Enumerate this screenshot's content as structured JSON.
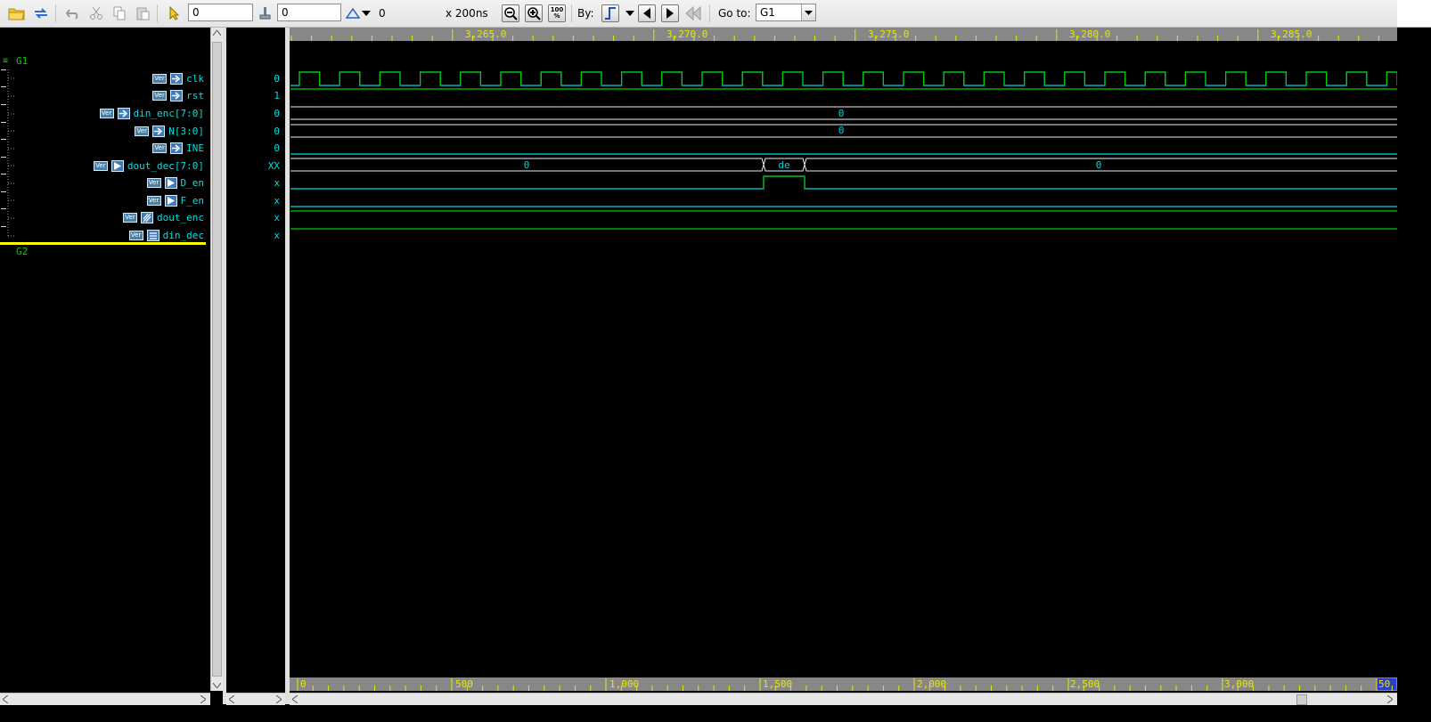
{
  "toolbar": {
    "time_value": "0",
    "cursor_value": "0",
    "delta_value": "0",
    "scale_label": "x 200ns",
    "zoom_full_label": "100 %",
    "by_label": "By:",
    "goto_label": "Go to:",
    "goto_value": "G1"
  },
  "tree": {
    "group1_label": "G1",
    "group2_label": "G2",
    "ver_badge": "Ver",
    "signals": [
      {
        "name": "clk",
        "value": "0",
        "icon": "input-arrow-icon"
      },
      {
        "name": "rst",
        "value": "1",
        "icon": "input-arrow-icon"
      },
      {
        "name": "din_enc[7:0]",
        "value": "0",
        "icon": "input-arrow-icon"
      },
      {
        "name": "N[3:0]",
        "value": "0",
        "icon": "input-arrow-icon"
      },
      {
        "name": "INE",
        "value": "0",
        "icon": "input-arrow-icon"
      },
      {
        "name": "dout_dec[7:0]",
        "value": "XX",
        "icon": "output-arrow-icon"
      },
      {
        "name": "D_en",
        "value": "x",
        "icon": "output-arrow-icon"
      },
      {
        "name": "F_en",
        "value": "x",
        "icon": "output-arrow-icon"
      },
      {
        "name": "dout_enc",
        "value": "x",
        "icon": "inout-icon"
      },
      {
        "name": "din_dec",
        "value": "x",
        "icon": "internal-icon"
      }
    ]
  },
  "wave": {
    "top_ticks": [
      "3,265.0",
      "3,270.0",
      "3,275.0",
      "3,280.0",
      "3,285.0"
    ],
    "bottom_ticks": [
      "0",
      "500",
      "1,000",
      "1,500",
      "2,000",
      "2,500",
      "3,000",
      "50"
    ],
    "din_enc_value": "0",
    "n_value": "0",
    "dout_dec_values": [
      "0",
      "de",
      "0"
    ]
  },
  "colors": {
    "signal_green": "#00d000",
    "signal_cyan": "#00d8d8",
    "bus_white": "#f0f0f0",
    "ruler_yellow": "#e8e800",
    "cursor_yellow": "#ffff00"
  }
}
